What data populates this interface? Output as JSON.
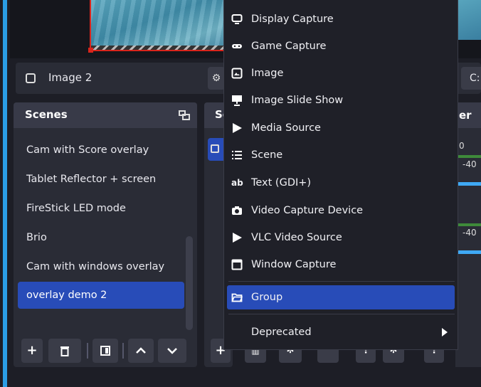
{
  "preview": {
    "source_label": "Image 2",
    "right_label": "C:"
  },
  "scenes": {
    "title": "Scenes",
    "items": [
      {
        "label": "Cam with Score overlay",
        "selected": false
      },
      {
        "label": "Tablet Reflector + screen",
        "selected": false
      },
      {
        "label": "FireStick LED mode",
        "selected": false
      },
      {
        "label": "Brio",
        "selected": false
      },
      {
        "label": "Cam with windows overlay",
        "selected": false
      },
      {
        "label": "overlay demo 2",
        "selected": true
      }
    ],
    "toolbar": [
      "add",
      "remove",
      "filters",
      "move-up",
      "move-down"
    ]
  },
  "sources": {
    "title_partial": "Sc"
  },
  "mixer": {
    "title_partial": "er",
    "labels": [
      "0",
      "-40",
      "-40"
    ]
  },
  "context_menu": {
    "items": [
      {
        "label": "Display Capture",
        "icon": "monitor-icon"
      },
      {
        "label": "Game Capture",
        "icon": "gamepad-icon"
      },
      {
        "label": "Image",
        "icon": "image-icon"
      },
      {
        "label": "Image Slide Show",
        "icon": "slideshow-icon"
      },
      {
        "label": "Media Source",
        "icon": "play-icon"
      },
      {
        "label": "Scene",
        "icon": "list-icon"
      },
      {
        "label": "Text (GDI+)",
        "icon": "text-icon"
      },
      {
        "label": "Video Capture Device",
        "icon": "camera-icon"
      },
      {
        "label": "VLC Video Source",
        "icon": "play-icon"
      },
      {
        "label": "Window Capture",
        "icon": "window-icon"
      }
    ],
    "group": {
      "label": "Group",
      "icon": "folder-icon",
      "highlighted": true
    },
    "deprecated": {
      "label": "Deprecated"
    }
  },
  "colors": {
    "accent": "#284cb8",
    "background": "#1d1e26",
    "panel": "#2a2c36",
    "preview_border": "#d9251c",
    "side_stripe": "#2b9ee6"
  }
}
